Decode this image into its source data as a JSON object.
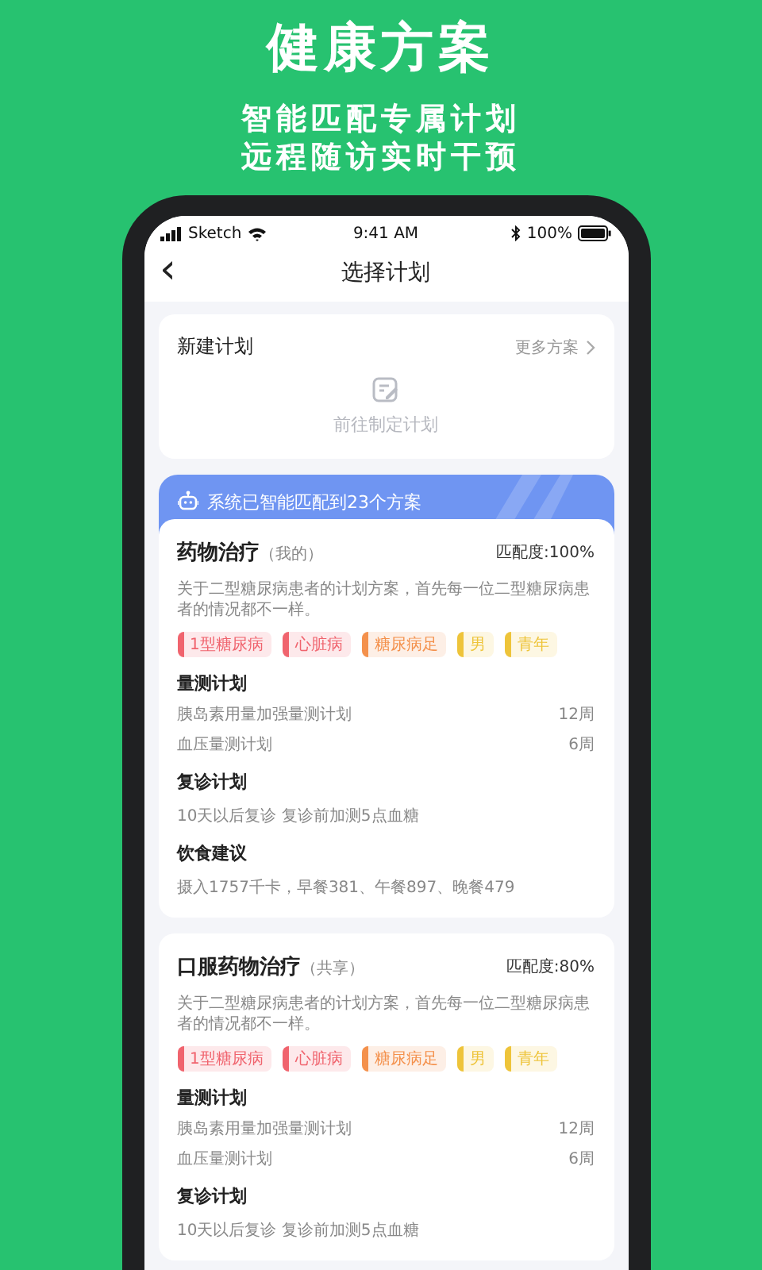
{
  "header": {
    "title": "健康方案",
    "subtitle_lines": [
      "智能匹配专属计划",
      "远程随访实时干预"
    ]
  },
  "status_bar": {
    "carrier": "Sketch",
    "time": "9:41 AM",
    "battery": "100%"
  },
  "nav": {
    "back": "‹",
    "title": "选择计划"
  },
  "new_plan": {
    "title": "新建计划",
    "more": "更多方案",
    "action": "前往制定计划"
  },
  "banner": {
    "text": "系统已智能匹配到23个方案"
  },
  "plans": [
    {
      "title": "药物治疗",
      "owner": "（我的）",
      "match": "匹配度:100%",
      "description": "关于二型糖尿病患者的计划方案，首先每一位二型糖尿病患者的情况都不一样。",
      "tags": [
        {
          "label": "1型糖尿病",
          "color": "#f0646e"
        },
        {
          "label": "心脏病",
          "color": "#f0646e"
        },
        {
          "label": "糖尿病足",
          "color": "#f4914c"
        },
        {
          "label": "男",
          "color": "#eec43a"
        },
        {
          "label": "青年",
          "color": "#eec43a"
        }
      ],
      "sections": [
        {
          "title": "量测计划",
          "kind": "list",
          "rows": [
            {
              "label": "胰岛素用量加强量测计划",
              "value": "12周"
            },
            {
              "label": "血压量测计划",
              "value": "6周"
            }
          ]
        },
        {
          "title": "复诊计划",
          "kind": "text",
          "text": "10天以后复诊  复诊前加测5点血糖"
        },
        {
          "title": "饮食建议",
          "kind": "text",
          "text": "摄入1757千卡，早餐381、午餐897、晚餐479"
        }
      ]
    },
    {
      "title": "口服药物治疗",
      "owner": "（共享）",
      "match": "匹配度:80%",
      "description": "关于二型糖尿病患者的计划方案，首先每一位二型糖尿病患者的情况都不一样。",
      "tags": [
        {
          "label": "1型糖尿病",
          "color": "#f0646e"
        },
        {
          "label": "心脏病",
          "color": "#f0646e"
        },
        {
          "label": "糖尿病足",
          "color": "#f4914c"
        },
        {
          "label": "男",
          "color": "#eec43a"
        },
        {
          "label": "青年",
          "color": "#eec43a"
        }
      ],
      "sections": [
        {
          "title": "量测计划",
          "kind": "list",
          "rows": [
            {
              "label": "胰岛素用量加强量测计划",
              "value": "12周"
            },
            {
              "label": "血压量测计划",
              "value": "6周"
            }
          ]
        },
        {
          "title": "复诊计划",
          "kind": "text",
          "text": "10天以后复诊  复诊前加测5点血糖"
        }
      ]
    }
  ]
}
